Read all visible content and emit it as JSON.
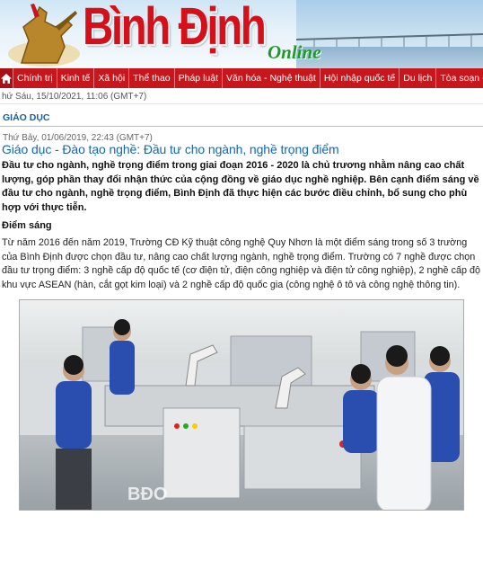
{
  "header": {
    "brand": "Bình Định",
    "brand_suffix": "Online",
    "brand_color": "#d4111a",
    "suffix_color": "#1c9a2a"
  },
  "nav": {
    "home_icon": "home-icon",
    "items": [
      "Chính trị",
      "Kinh tế",
      "Xã hội",
      "Thể thao",
      "Pháp luật",
      "Văn hóa - Nghệ thuật",
      "Hội nhập quốc tế",
      "Du lịch",
      "Tòa soạn - B"
    ],
    "color": "#c8161d"
  },
  "datebar": "hứ Sáu, 15/10/2021, 11:06 (GMT+7)",
  "section": "GIÁO DỤC",
  "article": {
    "date": "Thứ Bảy, 01/06/2019, 22:43 (GMT+7)",
    "title": "Giáo dục - Đào tạo nghề: Đầu tư cho ngành, nghề trọng điểm",
    "lead": "Đầu tư cho ngành, nghề trọng điểm trong giai đoạn 2016 - 2020 là chủ trương nhằm nâng cao chất lượng, góp phần thay đổi nhận thức của cộng đồng về giáo dục nghề nghiệp. Bên cạnh điểm sáng về đầu tư cho ngành, nghề trọng điểm, Bình Định đã thực hiện các bước điều chỉnh, bổ sung cho phù hợp với thực tiễn.",
    "subhead": "Điểm sáng",
    "body": "Từ năm 2016 đến năm 2019, Trường CĐ Kỹ thuật công nghệ Quy Nhơn là một điểm sáng trong số 3 trường của Bình Định được chọn đầu tư, nâng cao chất lượng ngành, nghề trọng điểm. Trường có 7  nghề được chọn đầu tư trọng điểm: 3 nghề cấp độ quốc tế (cơ điện tử, điện công nghiệp và điện tử công nghiệp), 2 nghề cấp độ khu vực ASEAN (hàn, cắt gọt kim loại) và 2 nghề cấp độ quốc gia (công nghệ ô tô và công nghệ thông tin).",
    "photo_watermark": "BĐO"
  }
}
